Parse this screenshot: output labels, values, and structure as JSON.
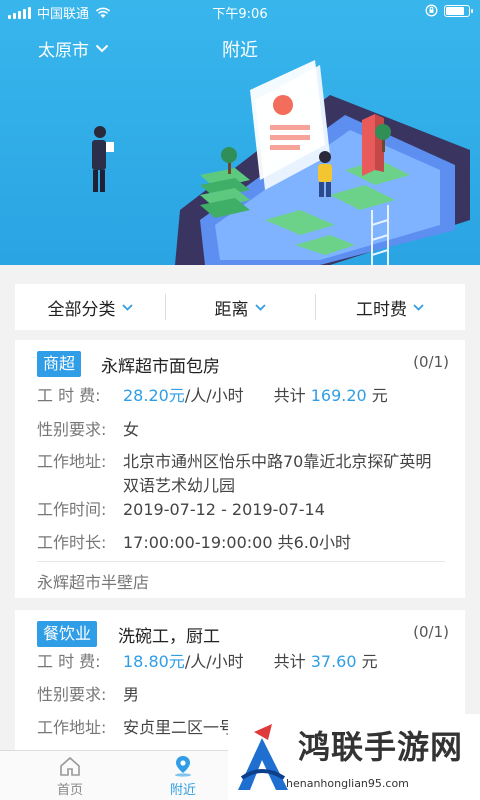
{
  "status_bar": {
    "carrier": "中国联通",
    "time": "下午9:06",
    "battery_level": 0.9
  },
  "header": {
    "city": "太原市",
    "title": "附近"
  },
  "filters": [
    {
      "label": "全部分类"
    },
    {
      "label": "距离"
    },
    {
      "label": "工时费"
    }
  ],
  "jobs": [
    {
      "category": "商超",
      "name": "永辉超市面包房",
      "count": "(0/1)",
      "fee_label": "工  时  费:",
      "fee_rate": "28.20元",
      "fee_unit": "/人/小时",
      "total_label": "共计",
      "total_value": "169.20",
      "total_unit": "元",
      "gender_label": "性别要求:",
      "gender": "女",
      "address_label": "工作地址:",
      "address": "北京市通州区怡乐中路70靠近北京探矿英明双语艺术幼儿园",
      "date_label": "工作时间:",
      "date": "2019-07-12 - 2019-07-14",
      "duration_label": "工作时长:",
      "duration": "17:00:00-19:00:00 共6.0小时",
      "store": "永辉超市半壁店"
    },
    {
      "category": "餐饮业",
      "name": "洗碗工，厨工",
      "count": "(0/1)",
      "fee_label": "工  时  费:",
      "fee_rate": "18.80元",
      "fee_unit": "/人/小时",
      "total_label": "共计",
      "total_value": "37.60",
      "total_unit": "元",
      "gender_label": "性别要求:",
      "gender": "男",
      "address_label": "工作地址:",
      "address": "安贞里二区一号楼金陋大厦南侧底商"
    }
  ],
  "tabs": [
    {
      "label": "首页"
    },
    {
      "label": "附近"
    }
  ],
  "watermark": {
    "title": "鸿联手游网",
    "url": "henanhonglian95.com"
  },
  "colors": {
    "accent": "#2f9ee6",
    "header_bg": "#2aa4e3"
  }
}
